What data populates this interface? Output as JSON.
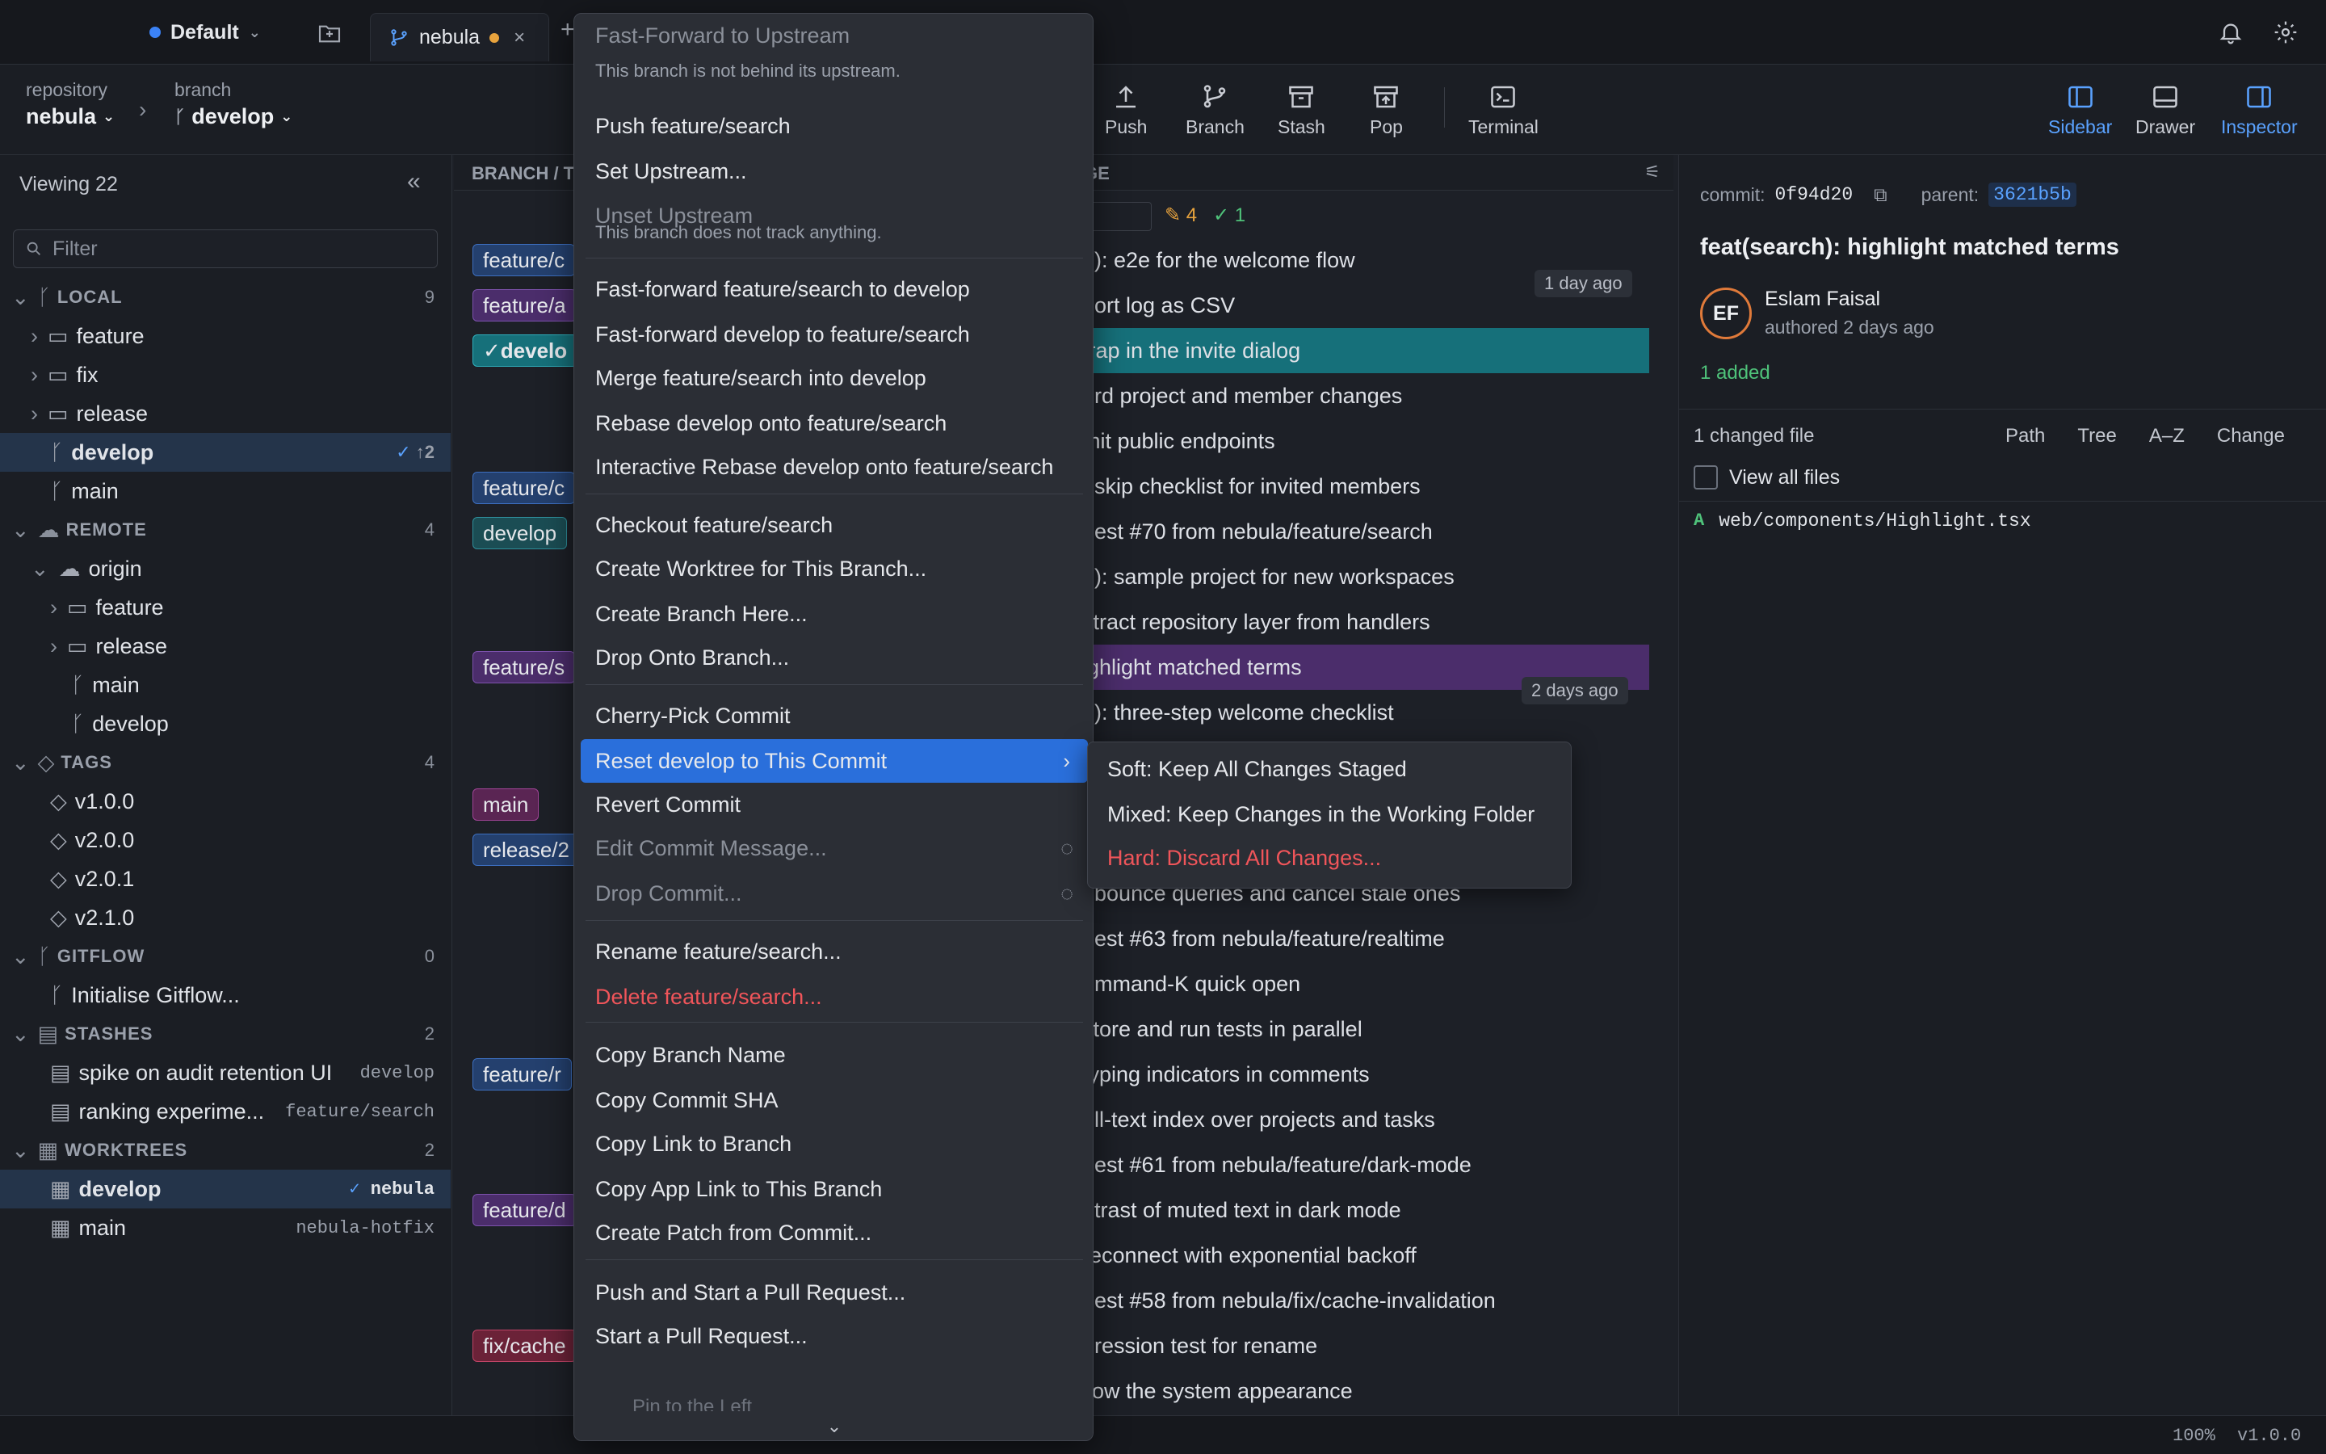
{
  "titlebar": {
    "workspace": "Default",
    "tab": "nebula"
  },
  "toolbar": {
    "repo_label": "repository",
    "repo": "nebula",
    "branch_label": "branch",
    "branch": "develop",
    "buttons": [
      "Push",
      "Branch",
      "Stash",
      "Pop",
      "Terminal"
    ],
    "views": [
      "Sidebar",
      "Drawer",
      "Inspector"
    ]
  },
  "sidebar": {
    "viewing": "Viewing 22",
    "filter_placeholder": "Filter",
    "local": {
      "title": "LOCAL",
      "count": "9",
      "items": [
        "feature",
        "fix",
        "release",
        "develop",
        "main"
      ],
      "develop_badge": "↑2"
    },
    "remote": {
      "title": "REMOTE",
      "count": "4",
      "origin": "origin",
      "items": [
        "feature",
        "release",
        "main",
        "develop"
      ]
    },
    "tags": {
      "title": "TAGS",
      "count": "4",
      "items": [
        "v1.0.0",
        "v2.0.0",
        "v2.0.1",
        "v2.1.0"
      ]
    },
    "gitflow": {
      "title": "GITFLOW",
      "count": "0",
      "action": "Initialise Gitflow..."
    },
    "stashes": {
      "title": "STASHES",
      "count": "2",
      "items": [
        {
          "name": "spike on audit retention UI",
          "branch": "develop"
        },
        {
          "name": "ranking experime...",
          "branch": "feature/search"
        }
      ]
    },
    "worktrees": {
      "title": "WORKTREES",
      "count": "2",
      "items": [
        {
          "name": "develop",
          "path": "nebula"
        },
        {
          "name": "main",
          "path": "nebula-hotfix"
        }
      ]
    }
  },
  "graph": {
    "col_branch": "BRANCH / T",
    "col_message": "GE",
    "counts": {
      "edited": "4",
      "ok": "1"
    },
    "refs": [
      "feature/c",
      "feature/a",
      "develo",
      "feature/c",
      "develop",
      "feature/s",
      "main",
      "release/2",
      "feature/r",
      "feature/d",
      "fix/cache"
    ],
    "commits": [
      "g): e2e for the welcome flow",
      "port log as CSV",
      "trap in the invite dialog",
      "ord project and member changes",
      "mit public endpoints",
      ": skip checklist for invited members",
      "uest #70 from nebula/feature/search",
      "g): sample project for new workspaces",
      "xtract repository layer from handlers",
      "ighlight matched terms",
      "g): three-step welcome checklist",
      "",
      "",
      "",
      "ebounce queries and cancel stale ones",
      "uest #63 from nebula/feature/realtime",
      "ommand-K quick open",
      "store and run tests in parallel",
      "typing indicators in comments",
      "ull-text index over projects and tasks",
      "uest #61 from nebula/feature/dark-mode",
      "ntrast of muted text in dark mode",
      "reconnect with exponential backoff",
      "uest #58 from nebula/fix/cache-invalidation",
      "gression test for rename",
      "llow the system appearance"
    ],
    "time1": "1 day ago",
    "time2": "2 days ago"
  },
  "inspector": {
    "commit_label": "commit:",
    "commit": "0f94d20",
    "parent_label": "parent:",
    "parent": "3621b5b",
    "title": "feat(search): highlight matched terms",
    "initials": "EF",
    "author": "Eslam Faisal",
    "authored": "authored 2 days ago",
    "added": "1 added",
    "changed": "1 changed file",
    "sort": [
      "Path",
      "Tree",
      "A–Z",
      "Change"
    ],
    "view_all": "View all files",
    "file_status": "A",
    "file": "web/components/Highlight.tsx"
  },
  "menu": {
    "items": [
      {
        "label": "Fast-Forward to Upstream",
        "sub": "This branch is not behind its upstream."
      },
      {
        "label": "Push feature/search"
      },
      {
        "label": "Set Upstream..."
      },
      {
        "label": "Unset Upstream",
        "sub": "This branch does not track anything."
      },
      {
        "label": "Fast-forward feature/search to develop"
      },
      {
        "label": "Fast-forward develop to feature/search"
      },
      {
        "label": "Merge feature/search into develop"
      },
      {
        "label": "Rebase develop onto feature/search"
      },
      {
        "label": "Interactive Rebase develop onto feature/search"
      },
      {
        "label": "Checkout feature/search"
      },
      {
        "label": "Create Worktree for This Branch..."
      },
      {
        "label": "Create Branch Here..."
      },
      {
        "label": "Drop Onto Branch..."
      },
      {
        "label": "Cherry-Pick Commit"
      },
      {
        "label": "Reset develop to This Commit"
      },
      {
        "label": "Revert Commit"
      },
      {
        "label": "Edit Commit Message..."
      },
      {
        "label": "Drop Commit..."
      },
      {
        "label": "Rename feature/search..."
      },
      {
        "label": "Delete feature/search..."
      },
      {
        "label": "Copy Branch Name"
      },
      {
        "label": "Copy Commit SHA"
      },
      {
        "label": "Copy Link to Branch"
      },
      {
        "label": "Copy App Link to This Branch"
      },
      {
        "label": "Create Patch from Commit..."
      },
      {
        "label": "Push and Start a Pull Request..."
      },
      {
        "label": "Start a Pull Request..."
      },
      {
        "label": "Pin to the Left"
      }
    ],
    "submenu": [
      "Soft: Keep All Changes Staged",
      "Mixed: Keep Changes in the Working Folder",
      "Hard: Discard All Changes..."
    ]
  },
  "status": {
    "zoom": "100%",
    "version": "v1.0.0"
  },
  "colors": {
    "accent": "#3b82f6",
    "danger": "#f0555a",
    "selected": "#2a6fdb"
  }
}
